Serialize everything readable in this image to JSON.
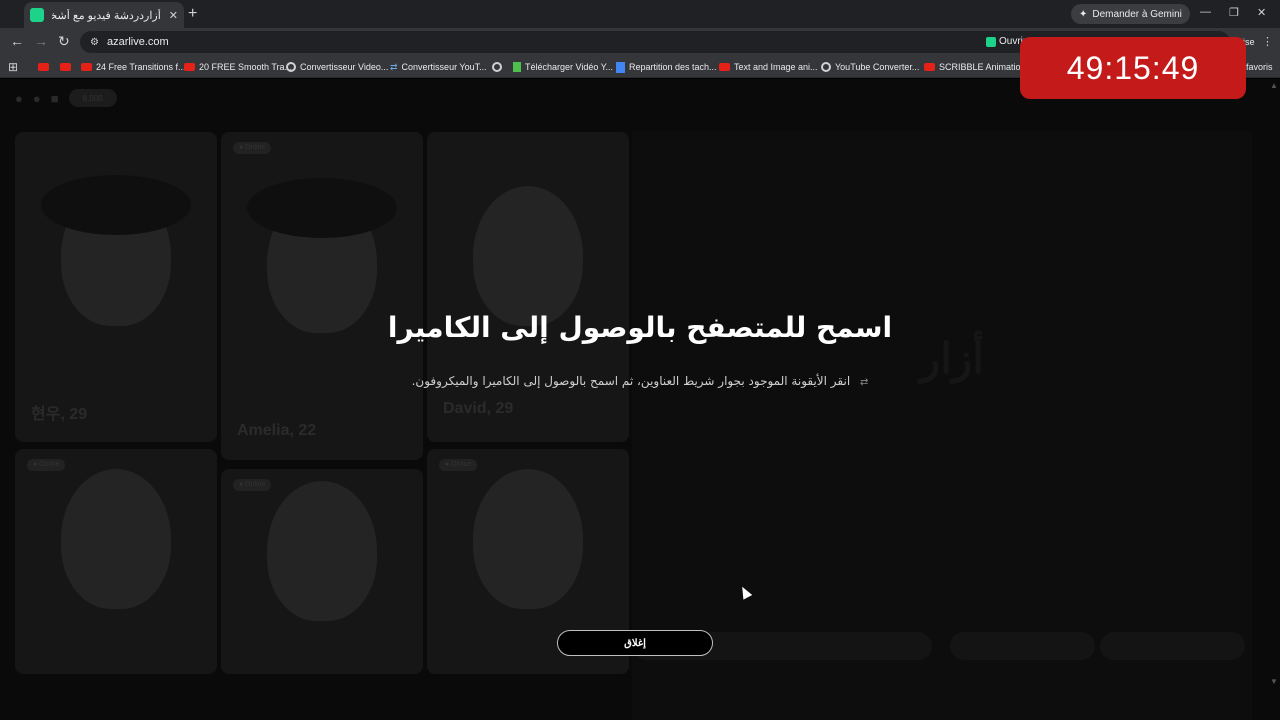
{
  "browser": {
    "tab_title": "أزاردردشة فيديو مع أشخاص جدد",
    "tab_close": "✕",
    "new_tab": "+",
    "gemini_label": "Demander à Gemini",
    "url": "azarlive.com",
    "ouvrir_label": "Ouvrir",
    "profile_fragment": "uise",
    "bookmarks": [
      {
        "icon": "youtube-icon",
        "label": ""
      },
      {
        "icon": "youtube-icon",
        "label": ""
      },
      {
        "icon": "youtube-icon",
        "label": "24 Free Transitions f..."
      },
      {
        "icon": "youtube-icon",
        "label": "20 FREE Smooth Tra..."
      },
      {
        "icon": "google-icon",
        "label": "Convertisseur Video..."
      },
      {
        "icon": "convert-icon",
        "label": "Convertisseur YouT..."
      },
      {
        "icon": "globe-icon",
        "label": ""
      },
      {
        "icon": "download-icon",
        "label": "Télécharger Vidéo Y..."
      },
      {
        "icon": "docs-icon",
        "label": "Repartition des tach..."
      },
      {
        "icon": "youtube-icon",
        "label": "Text and Image ani..."
      },
      {
        "icon": "globe-icon",
        "label": "YouTube Converter..."
      },
      {
        "icon": "youtube-icon",
        "label": "SCRIBBLE Animatio..."
      }
    ],
    "favoris_label": "favoris"
  },
  "page": {
    "top_pill": "8,000",
    "tiles": [
      {
        "name": "현우, 29",
        "tag": ""
      },
      {
        "name": "Amelia, 22",
        "tag": ""
      },
      {
        "name": "David, 29",
        "tag": ""
      },
      {
        "name": "",
        "tag": ""
      },
      {
        "name": "",
        "tag": ""
      },
      {
        "name": "",
        "tag": ""
      }
    ]
  },
  "modal": {
    "title": "اسمح للمتصفح بالوصول إلى الكاميرا",
    "description": "انقر الأيقونة الموجود بجوار شريط العناوين، ثم اسمح بالوصول إلى الكاميرا والميكروفون.",
    "close_label": "إغلاق"
  },
  "timer": {
    "value": "49:15:49",
    "color": "#c41a1a"
  },
  "colors": {
    "accent": "#1dd38a"
  }
}
